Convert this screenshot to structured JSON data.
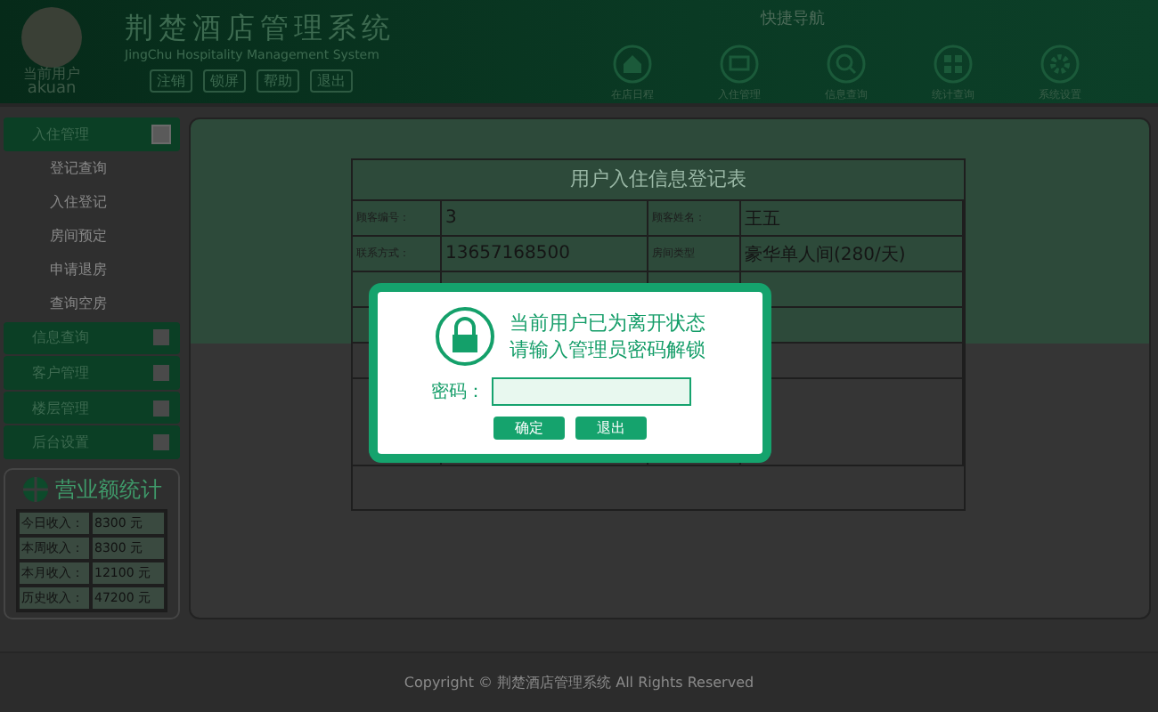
{
  "header": {
    "title": "荆楚酒店管理系统",
    "subtitle": "JingChu Hospitality Management System",
    "user_role": "当前用户",
    "user_name": "akuan",
    "user_buttons": [
      "注销",
      "锁屏",
      "帮助",
      "退出"
    ],
    "nav_title": "快捷导航",
    "nav": [
      {
        "label": "在店日程"
      },
      {
        "label": "入住管理"
      },
      {
        "label": "信息查询"
      },
      {
        "label": "统计查询"
      },
      {
        "label": "系统设置"
      }
    ]
  },
  "sidebar": {
    "groups": [
      {
        "label": "入住管理",
        "expanded": true,
        "children": [
          "登记查询",
          "入住登记",
          "房间预定",
          "申请退房",
          "查询空房"
        ]
      },
      {
        "label": "信息查询",
        "expanded": false
      },
      {
        "label": "客户管理",
        "expanded": false
      },
      {
        "label": "楼层管理",
        "expanded": false
      },
      {
        "label": "后台设置",
        "expanded": false
      }
    ]
  },
  "stats": {
    "title": "营业额统计",
    "rows": [
      {
        "label": "今日收入：",
        "value": "8300 元"
      },
      {
        "label": "本周收入：",
        "value": "8300 元"
      },
      {
        "label": "本月收入：",
        "value": "12100 元"
      },
      {
        "label": "历史收入：",
        "value": "47200 元"
      }
    ]
  },
  "form": {
    "title": "用户入住信息登记表",
    "rows": [
      {
        "label_1": "顾客编号：",
        "value_1": "3",
        "label_2": "顾客姓名：",
        "value_2": "王五"
      },
      {
        "label_1": "联系方式：",
        "value_1": "13657168500",
        "label_2": "房间类型",
        "value_2": "豪华单人间(280/天)"
      }
    ]
  },
  "dialog": {
    "line_1": "当前用户已为离开状态",
    "line_2": "请输入管理员密码解锁",
    "password_label": "密码：",
    "buttons": [
      "确定",
      "退出"
    ]
  },
  "footer": {
    "line_1": "Copyright © 荆楚酒店管理系统 All Rights Reserved"
  }
}
